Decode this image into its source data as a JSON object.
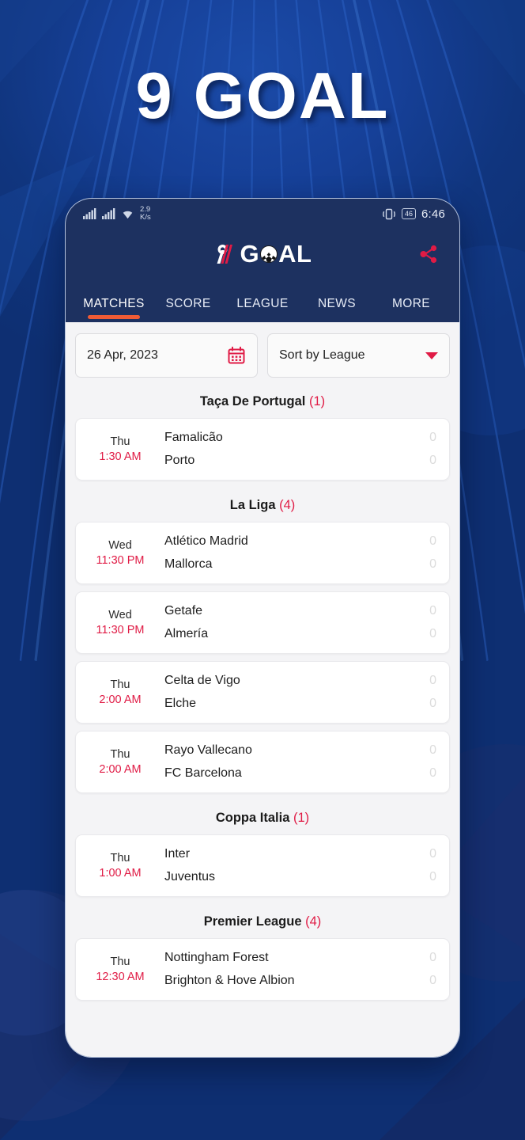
{
  "promo": {
    "title": "9 GOAL"
  },
  "status_bar": {
    "signal_1": "signal-bars-icon",
    "signal_2": "signal-bars-icon",
    "wifi": "wifi-icon",
    "net_rate_value": "2.9",
    "net_rate_unit": "K/s",
    "vibrate": "vibrate-icon",
    "battery": "46",
    "time": "6:46"
  },
  "app_bar": {
    "logo_mark": "nine-slash-icon",
    "logo_g": "G",
    "logo_ball": "soccer-ball-icon",
    "logo_al": "AL",
    "share": "share-icon"
  },
  "tabs": [
    {
      "label": "MATCHES",
      "active": true
    },
    {
      "label": "SCORE",
      "active": false
    },
    {
      "label": "LEAGUE",
      "active": false
    },
    {
      "label": "NEWS",
      "active": false
    },
    {
      "label": "MORE",
      "active": false
    }
  ],
  "filters": {
    "date_value": "26 Apr, 2023",
    "date_icon": "calendar-icon",
    "sort_value": "Sort by League",
    "sort_icon": "chevron-down-icon"
  },
  "colors": {
    "accent_red": "#e01b45",
    "accent_orange": "#ef5b35",
    "app_bar_navy": "#1d3160",
    "promo_blue": "#10357e",
    "content_bg": "#f4f4f6",
    "score_gray": "#dcdcdc"
  },
  "leagues": [
    {
      "name": "Taça De Portugal",
      "count": "(1)",
      "matches": [
        {
          "day": "Thu",
          "time": "1:30 AM",
          "home": "Famalicão",
          "away": "Porto",
          "home_score": "0",
          "away_score": "0"
        }
      ]
    },
    {
      "name": "La Liga",
      "count": "(4)",
      "matches": [
        {
          "day": "Wed",
          "time": "11:30 PM",
          "home": "Atlético Madrid",
          "away": "Mallorca",
          "home_score": "0",
          "away_score": "0"
        },
        {
          "day": "Wed",
          "time": "11:30 PM",
          "home": "Getafe",
          "away": "Almería",
          "home_score": "0",
          "away_score": "0"
        },
        {
          "day": "Thu",
          "time": "2:00 AM",
          "home": "Celta de Vigo",
          "away": "Elche",
          "home_score": "0",
          "away_score": "0"
        },
        {
          "day": "Thu",
          "time": "2:00 AM",
          "home": "Rayo Vallecano",
          "away": "FC Barcelona",
          "home_score": "0",
          "away_score": "0"
        }
      ]
    },
    {
      "name": "Coppa Italia",
      "count": "(1)",
      "matches": [
        {
          "day": "Thu",
          "time": "1:00 AM",
          "home": "Inter",
          "away": "Juventus",
          "home_score": "0",
          "away_score": "0"
        }
      ]
    },
    {
      "name": "Premier League",
      "count": "(4)",
      "matches": [
        {
          "day": "Thu",
          "time": "12:30 AM",
          "home": "Nottingham Forest",
          "away": "Brighton & Hove Albion",
          "home_score": "0",
          "away_score": "0"
        }
      ]
    }
  ]
}
